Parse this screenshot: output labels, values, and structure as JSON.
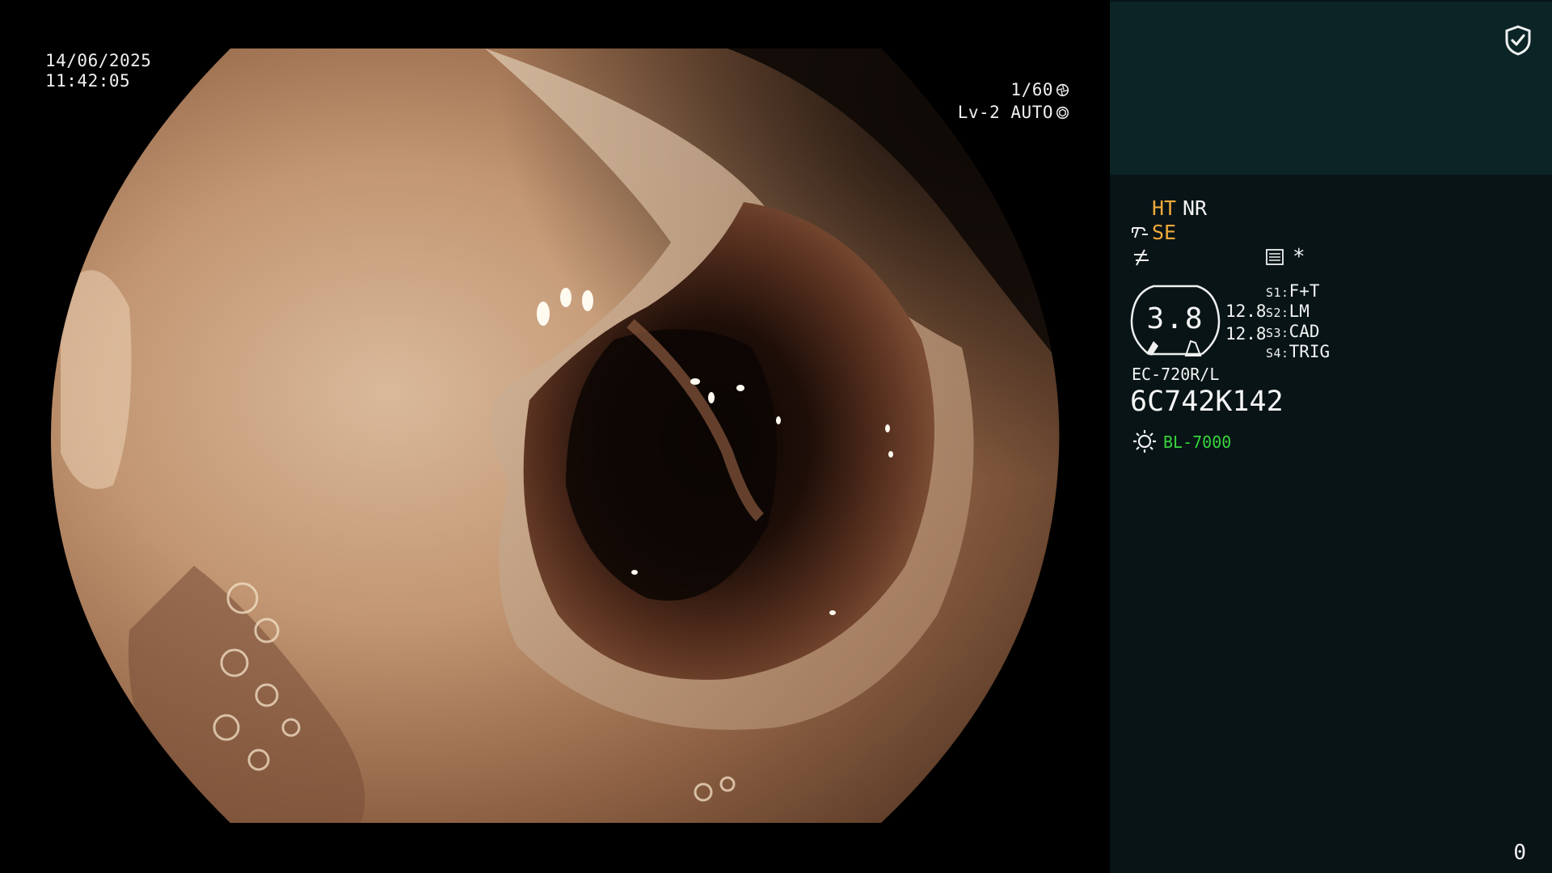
{
  "overlay": {
    "date": "14/06/2025",
    "time": "11:42:05",
    "shutter": "1/60",
    "iris": "Lv-2 AUTO"
  },
  "panel": {
    "modes": {
      "ht": "HT",
      "nr": "NR",
      "se": "SE",
      "asterisk": "*"
    },
    "gauge": {
      "value": "3.8",
      "left_value_top": "12.8",
      "left_value_bottom": "12.8"
    },
    "switches": [
      {
        "key": "S1:",
        "value": "F+T"
      },
      {
        "key": "S2:",
        "value": "LM"
      },
      {
        "key": "S3:",
        "value": "CAD"
      },
      {
        "key": "S4:",
        "value": "TRIG"
      }
    ],
    "scope_model": "EC-720R/L",
    "scope_serial": "6C742K142",
    "light_source": "BL-7000",
    "counter": "0",
    "colors": {
      "panel_bg": "#081416",
      "panel_top_bg": "#0b2426",
      "accent_orange": "#f0a93a",
      "light_green": "#37d43c"
    },
    "icons": [
      "shield-check-icon",
      "scope-bend-icon",
      "function-icon",
      "record-list-icon",
      "gauge-icon",
      "light-source-icon",
      "shutter-icon",
      "iris-icon"
    ]
  }
}
